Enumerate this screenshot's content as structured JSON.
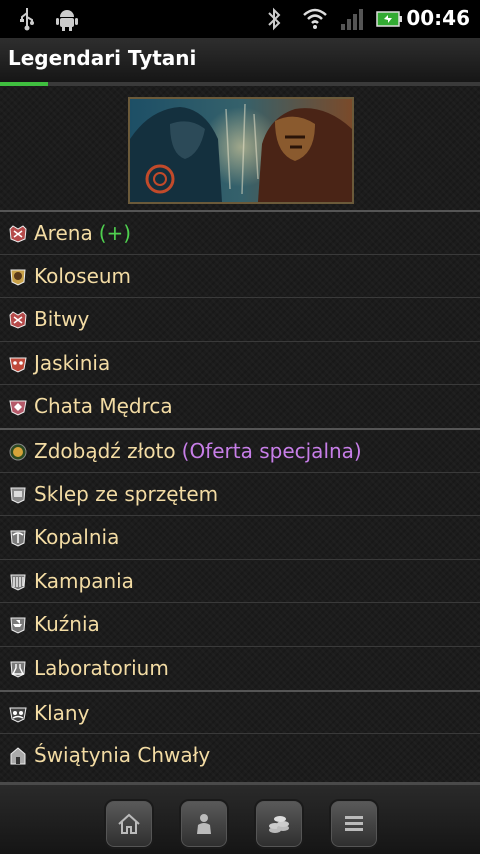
{
  "status_bar": {
    "time": "00:46",
    "icons": [
      "usb-icon",
      "android-debug-icon",
      "bluetooth-icon",
      "wifi-icon",
      "signal-icon",
      "battery-icon"
    ]
  },
  "app": {
    "title": "Legendari Tytani",
    "load_progress": 0.1
  },
  "banner": {
    "alt": ""
  },
  "menu": {
    "items": [
      {
        "label": "Arena",
        "extra": "(+)",
        "extra_color": "#4fd04f",
        "icon": "arena-icon"
      },
      {
        "label": "Koloseum",
        "extra": "",
        "icon": "colosseum-icon"
      },
      {
        "label": "Bitwy",
        "extra": "",
        "icon": "battles-icon"
      },
      {
        "label": "Jaskinia",
        "extra": "",
        "icon": "cave-icon"
      },
      {
        "label": "Chata Mędrca",
        "extra": "",
        "icon": "sage-hut-icon"
      },
      {
        "label": "Zdobądź złoto",
        "extra": "(Oferta specjalna)",
        "extra_color": "#c77ee8",
        "icon": "gold-icon"
      },
      {
        "label": "Sklep ze sprzętem",
        "extra": "",
        "icon": "shop-icon"
      },
      {
        "label": "Kopalnia",
        "extra": "",
        "icon": "mine-icon"
      },
      {
        "label": "Kampania",
        "extra": "",
        "icon": "campaign-icon"
      },
      {
        "label": "Kuźnia",
        "extra": "",
        "icon": "forge-icon"
      },
      {
        "label": "Laboratorium",
        "extra": "",
        "icon": "laboratory-icon"
      },
      {
        "label": "Klany",
        "extra": "",
        "icon": "clans-icon"
      },
      {
        "label": "Świątynia Chwały",
        "extra": "",
        "icon": "temple-icon"
      }
    ]
  },
  "bottom_nav": [
    "home-icon",
    "character-icon",
    "coins-icon",
    "menu-list-icon"
  ]
}
